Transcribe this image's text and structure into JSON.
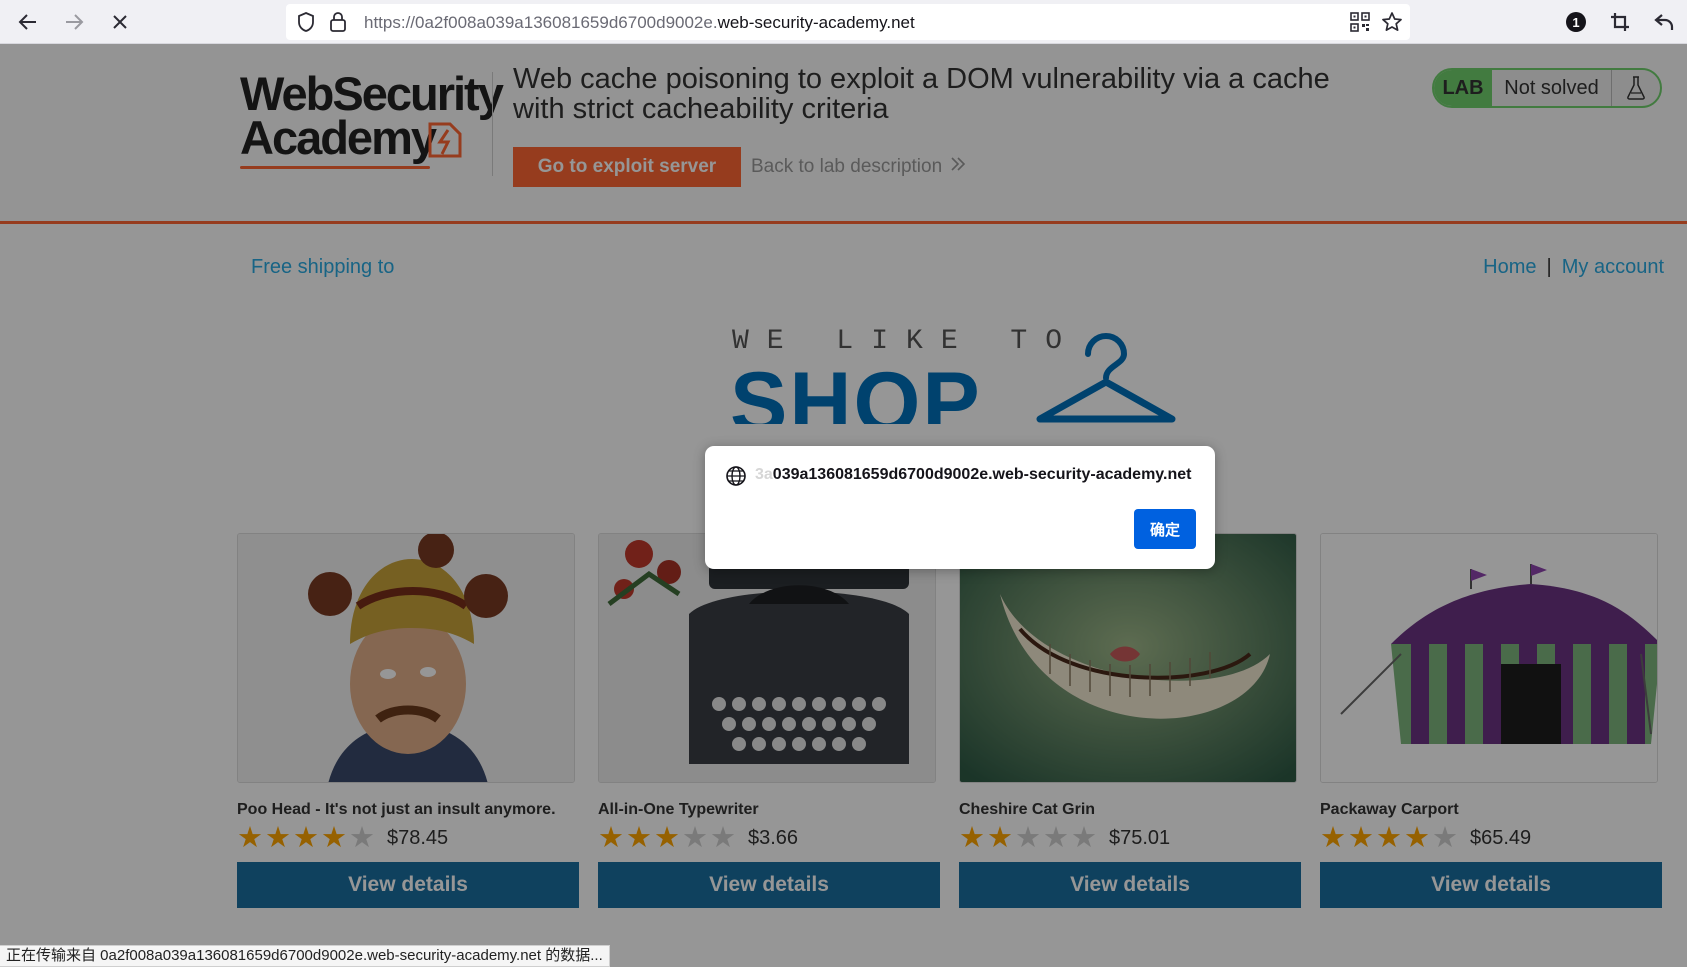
{
  "browser": {
    "url_prefix": "https://0a2f008a039a136081659d6700d9002e.",
    "url_domain": "web-security-academy.net",
    "extension_badge": "1",
    "status_text": "正在传输来自 0a2f008a039a136081659d6700d9002e.web-security-academy.net 的数据..."
  },
  "lab": {
    "logo_line1": "WebSecurity",
    "logo_line2": "Academy",
    "title": "Web cache poisoning to exploit a DOM vulnerability via a cache with strict cacheability criteria",
    "exploit_button": "Go to exploit server",
    "back_link": "Back to lab description",
    "badge_label": "LAB",
    "status": "Not solved",
    "accent_color": "#ff6633",
    "solved_color": "#70d16d"
  },
  "shop": {
    "free_shipping": "Free shipping to",
    "nav_home": "Home",
    "nav_separator": "|",
    "nav_account": "My account",
    "hero_small": "WE LIKE TO",
    "hero_big": "SHOP",
    "products": [
      {
        "name": "Poo Head - It's not just an insult anymore.",
        "rating": 4,
        "price": "$78.45",
        "button": "View details",
        "image": "man-in-poo-head-hat"
      },
      {
        "name": "All-in-One Typewriter",
        "rating": 3,
        "price": "$3.66",
        "button": "View details",
        "image": "vintage-typewriter-with-roses"
      },
      {
        "name": "Cheshire Cat Grin",
        "rating": 2,
        "price": "$75.01",
        "button": "View details",
        "image": "cheshire-cat-grin"
      },
      {
        "name": "Packaway Carport",
        "rating": 4,
        "price": "$65.49",
        "button": "View details",
        "image": "striped-carnival-tent"
      }
    ]
  },
  "dialog": {
    "origin_faded": "3a",
    "origin": "039a136081659d6700d9002e.web-security-academy.net",
    "ok_button": "确定"
  }
}
